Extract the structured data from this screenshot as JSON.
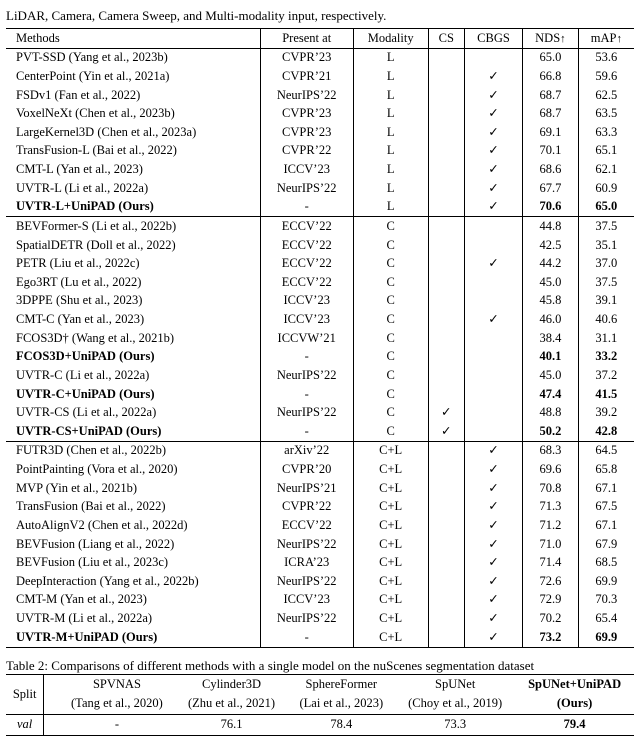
{
  "topcaption": "LiDAR, Camera, Camera Sweep, and Multi-modality input, respectively.",
  "t1": {
    "h": {
      "methods": "Methods",
      "presentat": "Present at",
      "modality": "Modality",
      "cs": "CS",
      "cbgs": "CBGS",
      "nds": "NDS",
      "map": "mAP",
      "up": "↑"
    },
    "g1": [
      {
        "m": "PVT-SSD (Yang et al., 2023b)",
        "p": "CVPR’23",
        "mod": "L",
        "cs": "",
        "cbgs": "",
        "nds": "65.0",
        "map": "53.6"
      },
      {
        "m": "CenterPoint (Yin et al., 2021a)",
        "p": "CVPR’21",
        "mod": "L",
        "cs": "",
        "cbgs": "y",
        "nds": "66.8",
        "map": "59.6"
      },
      {
        "m": "FSDv1 (Fan et al., 2022)",
        "p": "NeurIPS’22",
        "mod": "L",
        "cs": "",
        "cbgs": "y",
        "nds": "68.7",
        "map": "62.5"
      },
      {
        "m": "VoxelNeXt (Chen et al., 2023b)",
        "p": "CVPR’23",
        "mod": "L",
        "cs": "",
        "cbgs": "y",
        "nds": "68.7",
        "map": "63.5"
      },
      {
        "m": "LargeKernel3D (Chen et al., 2023a)",
        "p": "CVPR’23",
        "mod": "L",
        "cs": "",
        "cbgs": "y",
        "nds": "69.1",
        "map": "63.3"
      },
      {
        "m": "TransFusion-L (Bai et al., 2022)",
        "p": "CVPR’22",
        "mod": "L",
        "cs": "",
        "cbgs": "y",
        "nds": "70.1",
        "map": "65.1"
      },
      {
        "m": "CMT-L (Yan et al., 2023)",
        "p": "ICCV’23",
        "mod": "L",
        "cs": "",
        "cbgs": "y",
        "nds": "68.6",
        "map": "62.1"
      },
      {
        "m": "UVTR-L (Li et al., 2022a)",
        "p": "NeurIPS’22",
        "mod": "L",
        "cs": "",
        "cbgs": "y",
        "nds": "67.7",
        "map": "60.9"
      },
      {
        "m": "UVTR-L+UniPAD (Ours)",
        "p": "-",
        "mod": "L",
        "cs": "",
        "cbgs": "y",
        "nds": "70.6",
        "map": "65.0",
        "bold": true
      }
    ],
    "g2": [
      {
        "m": "BEVFormer-S (Li et al., 2022b)",
        "p": "ECCV’22",
        "mod": "C",
        "cs": "",
        "cbgs": "",
        "nds": "44.8",
        "map": "37.5"
      },
      {
        "m": "SpatialDETR (Doll et al., 2022)",
        "p": "ECCV’22",
        "mod": "C",
        "cs": "",
        "cbgs": "",
        "nds": "42.5",
        "map": "35.1"
      },
      {
        "m": "PETR (Liu et al., 2022c)",
        "p": "ECCV’22",
        "mod": "C",
        "cs": "",
        "cbgs": "y",
        "nds": "44.2",
        "map": "37.0"
      },
      {
        "m": "Ego3RT (Lu et al., 2022)",
        "p": "ECCV’22",
        "mod": "C",
        "cs": "",
        "cbgs": "",
        "nds": "45.0",
        "map": "37.5"
      },
      {
        "m": "3DPPE (Shu et al., 2023)",
        "p": "ICCV’23",
        "mod": "C",
        "cs": "",
        "cbgs": "",
        "nds": "45.8",
        "map": "39.1"
      },
      {
        "m": "CMT-C (Yan et al., 2023)",
        "p": "ICCV’23",
        "mod": "C",
        "cs": "",
        "cbgs": "y",
        "nds": "46.0",
        "map": "40.6"
      },
      {
        "m": "FCOS3D† (Wang et al., 2021b)",
        "p": "ICCVW’21",
        "mod": "C",
        "cs": "",
        "cbgs": "",
        "nds": "38.4",
        "map": "31.1"
      },
      {
        "m": "FCOS3D+UniPAD (Ours)",
        "p": "-",
        "mod": "C",
        "cs": "",
        "cbgs": "",
        "nds": "40.1",
        "map": "33.2",
        "bold": true
      },
      {
        "m": "UVTR-C (Li et al., 2022a)",
        "p": "NeurIPS’22",
        "mod": "C",
        "cs": "",
        "cbgs": "",
        "nds": "45.0",
        "map": "37.2"
      },
      {
        "m": "UVTR-C+UniPAD (Ours)",
        "p": "-",
        "mod": "C",
        "cs": "",
        "cbgs": "",
        "nds": "47.4",
        "map": "41.5",
        "bold": true
      },
      {
        "m": "UVTR-CS (Li et al., 2022a)",
        "p": "NeurIPS’22",
        "mod": "C",
        "cs": "y",
        "cbgs": "",
        "nds": "48.8",
        "map": "39.2"
      },
      {
        "m": "UVTR-CS+UniPAD (Ours)",
        "p": "-",
        "mod": "C",
        "cs": "y",
        "cbgs": "",
        "nds": "50.2",
        "map": "42.8",
        "bold": true
      }
    ],
    "g3": [
      {
        "m": "FUTR3D (Chen et al., 2022b)",
        "p": "arXiv’22",
        "mod": "C+L",
        "cs": "",
        "cbgs": "y",
        "nds": "68.3",
        "map": "64.5"
      },
      {
        "m": "PointPainting (Vora et al., 2020)",
        "p": "CVPR’20",
        "mod": "C+L",
        "cs": "",
        "cbgs": "y",
        "nds": "69.6",
        "map": "65.8"
      },
      {
        "m": "MVP (Yin et al., 2021b)",
        "p": "NeurIPS’21",
        "mod": "C+L",
        "cs": "",
        "cbgs": "y",
        "nds": "70.8",
        "map": "67.1"
      },
      {
        "m": "TransFusion (Bai et al., 2022)",
        "p": "CVPR’22",
        "mod": "C+L",
        "cs": "",
        "cbgs": "y",
        "nds": "71.3",
        "map": "67.5"
      },
      {
        "m": "AutoAlignV2 (Chen et al., 2022d)",
        "p": "ECCV’22",
        "mod": "C+L",
        "cs": "",
        "cbgs": "y",
        "nds": "71.2",
        "map": "67.1"
      },
      {
        "m": "BEVFusion (Liang et al., 2022)",
        "p": "NeurIPS’22",
        "mod": "C+L",
        "cs": "",
        "cbgs": "y",
        "nds": "71.0",
        "map": "67.9"
      },
      {
        "m": "BEVFusion (Liu et al., 2023c)",
        "p": "ICRA’23",
        "mod": "C+L",
        "cs": "",
        "cbgs": "y",
        "nds": "71.4",
        "map": "68.5"
      },
      {
        "m": "DeepInteraction (Yang et al., 2022b)",
        "p": "NeurIPS’22",
        "mod": "C+L",
        "cs": "",
        "cbgs": "y",
        "nds": "72.6",
        "map": "69.9"
      },
      {
        "m": "CMT-M (Yan et al., 2023)",
        "p": "ICCV’23",
        "mod": "C+L",
        "cs": "",
        "cbgs": "y",
        "nds": "72.9",
        "map": "70.3"
      },
      {
        "m": "UVTR-M (Li et al., 2022a)",
        "p": "NeurIPS’22",
        "mod": "C+L",
        "cs": "",
        "cbgs": "y",
        "nds": "70.2",
        "map": "65.4"
      },
      {
        "m": "UVTR-M+UniPAD (Ours)",
        "p": "-",
        "mod": "C+L",
        "cs": "",
        "cbgs": "y",
        "nds": "73.2",
        "map": "69.9",
        "bold": true
      }
    ]
  },
  "t2": {
    "caption": "Table 2: Comparisons of different methods with a single model on the nuScenes segmentation dataset",
    "h": {
      "split": "Split",
      "c1a": "SPVNAS",
      "c1b": "(Tang et al., 2020)",
      "c2a": "Cylinder3D",
      "c2b": "(Zhu et al., 2021)",
      "c3a": "SphereFormer",
      "c3b": "(Lai et al., 2023)",
      "c4a": "SpUNet",
      "c4b": "(Choy et al., 2019)",
      "c5a": "SpUNet+UniPAD",
      "c5b": "(Ours)"
    },
    "row": {
      "split": "val",
      "v1": "-",
      "v2": "76.1",
      "v3": "78.4",
      "v4": "73.3",
      "v5": "79.4"
    }
  }
}
